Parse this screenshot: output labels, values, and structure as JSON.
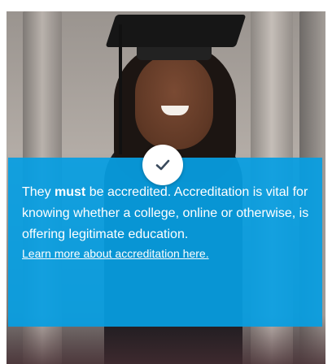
{
  "card": {
    "text_before": "They ",
    "text_bold": "must",
    "text_after": " be accredited. Accreditation is vital for knowing whether a college, online or otherwise, is offering legitimate education.",
    "link_label": "Learn more about accreditation here.",
    "overlay_color": "#069EE2",
    "badge_icon": "checkmark-icon",
    "photo": "graduate-photo"
  }
}
